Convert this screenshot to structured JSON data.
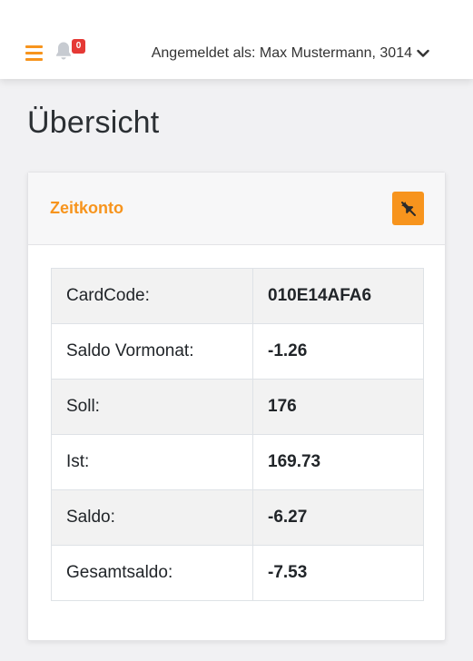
{
  "navbar": {
    "menu_icon": "hamburger-menu-icon",
    "bell_icon": "bell-icon",
    "notification_count": "0",
    "user_label": "Angemeldet als: Max Mustermann, 3014",
    "user_chevron_icon": "chevron-down-icon"
  },
  "page": {
    "title": "Übersicht"
  },
  "card": {
    "title": "Zeitkonto",
    "unpin_icon": "unpin-icon",
    "rows": [
      {
        "label": "CardCode:",
        "value": "010E14AFA6"
      },
      {
        "label": "Saldo Vormonat:",
        "value": "-1.26"
      },
      {
        "label": "Soll:",
        "value": "176"
      },
      {
        "label": "Ist:",
        "value": "169.73"
      },
      {
        "label": "Saldo:",
        "value": "-6.27"
      },
      {
        "label": "Gesamtsaldo:",
        "value": "-7.53"
      }
    ]
  },
  "colors": {
    "accent": "#f7941d",
    "badge": "#e53935",
    "background": "#f1f1f3",
    "row_stripe": "#f2f2f2"
  }
}
